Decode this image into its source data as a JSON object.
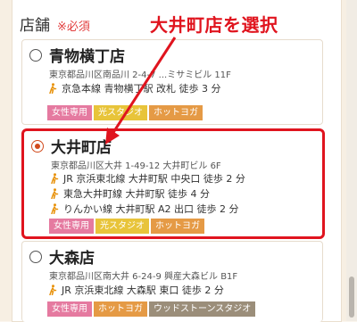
{
  "form": {
    "field_label": "店舗",
    "required_label": "※必須"
  },
  "annotation": {
    "callout_text": "大井町店を選択",
    "color": "#e0141e"
  },
  "stores": [
    {
      "name": "青物横丁店",
      "selected": false,
      "address": "東京都品川区南品川 2-4-7 ...ミサミビル 11F",
      "access": [
        "京急本線 青物横丁駅 改札 徒歩 3 分"
      ],
      "tags": [
        "女性専用",
        "光スタジオ",
        "ホットヨガ"
      ]
    },
    {
      "name": "大井町店",
      "selected": true,
      "address": "東京都品川区大井 1-49-12 大井町ビル 6F",
      "access": [
        "JR 京浜東北線 大井町駅 中央口 徒歩 2 分",
        "東急大井町線 大井町駅 徒歩 4 分",
        "りんかい線 大井町駅 A2 出口 徒歩 2 分"
      ],
      "tags": [
        "女性専用",
        "光スタジオ",
        "ホットヨガ"
      ]
    },
    {
      "name": "大森店",
      "selected": false,
      "address": "東京都品川区南大井 6-24-9 興産大森ビル B1F",
      "access": [
        "JR 京浜東北線 大森駅 東口 徒歩 2 分"
      ],
      "tags": [
        "女性専用",
        "ホットヨガ",
        "ウッドストーンスタジオ"
      ]
    }
  ],
  "icons": {
    "walk": "walking-person-icon",
    "radio": "radio-button-icon"
  },
  "colors": {
    "walk_icon": "#e8920b",
    "tag_women_only": "#e57aa0",
    "tag_light_studio": "#e8c43a",
    "tag_hot_yoga": "#e59a45",
    "tag_woodstone": "#9b8e7a"
  }
}
